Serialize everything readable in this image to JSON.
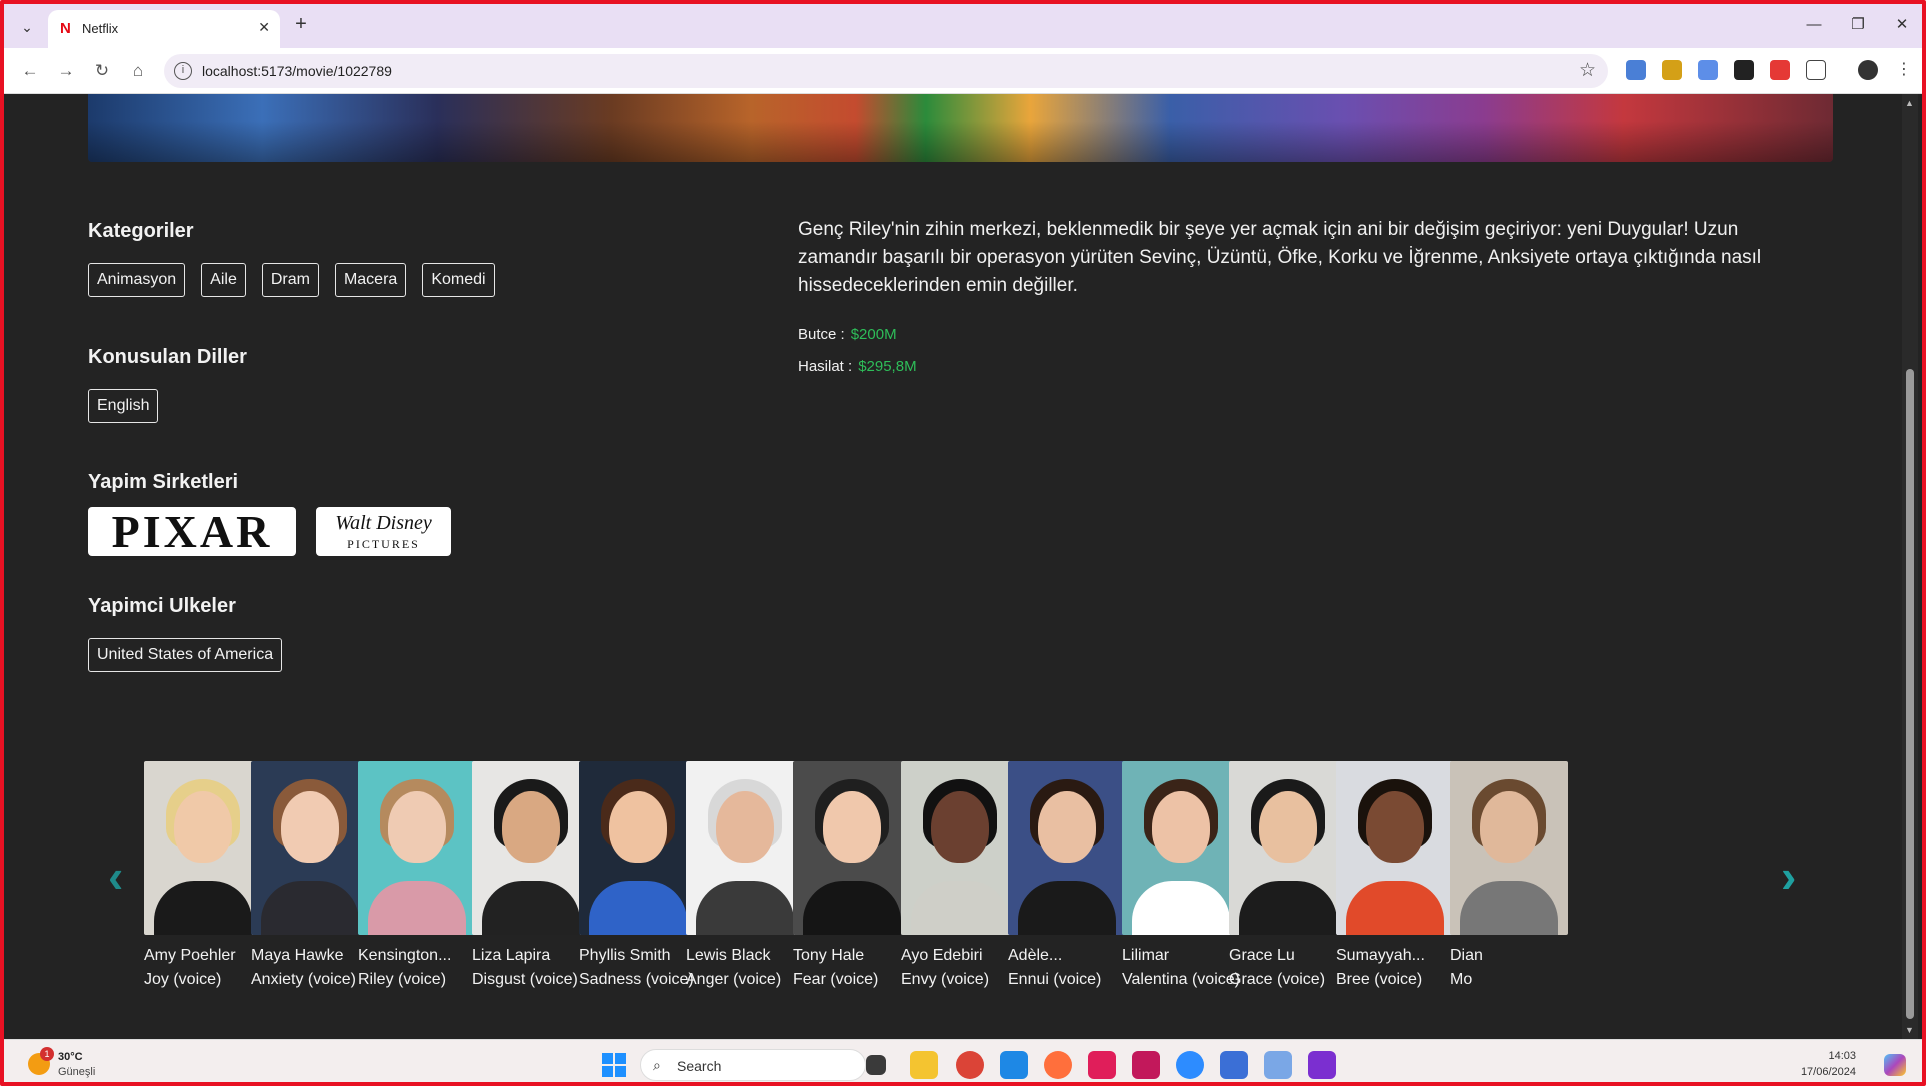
{
  "browser": {
    "tab_title": "Netflix",
    "tab_favicon": "N",
    "url": "localhost:5173/movie/1022789",
    "new_tab_symbol": "+",
    "close_symbol": "✕"
  },
  "movie": {
    "overview": "Genç Riley'nin zihin merkezi, beklenmedik bir şeye yer açmak için ani bir değişim geçiriyor: yeni Duygular! Uzun zamandır başarılı bir operasyon yürüten Sevinç, Üzüntü, Öfke, Korku ve İğrenme, Anksiyete ortaya çıktığında nasıl hissedeceklerinden emin değiller.",
    "budget_label": "Butce :",
    "budget_value": "$200M",
    "revenue_label": "Hasilat :",
    "revenue_value": "$295,8M"
  },
  "sections": {
    "categories_title": "Kategoriler",
    "categories": [
      "Animasyon",
      "Aile",
      "Dram",
      "Macera",
      "Komedi"
    ],
    "languages_title": "Konusulan Diller",
    "languages": [
      "English"
    ],
    "companies_title": "Yapim Sirketleri",
    "companies": {
      "pixar": "PIXAR",
      "disney_line1": "Walt Disney",
      "disney_line2": "PICTURES"
    },
    "countries_title": "Yapimci Ulkeler",
    "countries": [
      "United States of America"
    ]
  },
  "cast": [
    {
      "name": "Amy Poehler",
      "role": "Joy (voice)",
      "skin": "#f0c9a8",
      "hair": "#e6cf8a",
      "shirt": "#1a1a1a",
      "bg": "#d9d6cf"
    },
    {
      "name": "Maya Hawke",
      "role": "Anxiety (voice)",
      "skin": "#f1cbb2",
      "hair": "#8a5a3a",
      "shirt": "#2a2a30",
      "bg": "#2b3b55"
    },
    {
      "name": "Kensington...",
      "role": "Riley (voice)",
      "skin": "#efcbb3",
      "hair": "#b58a5e",
      "shirt": "#d99aa8",
      "bg": "#5cc3c4"
    },
    {
      "name": "Liza Lapira",
      "role": "Disgust (voice)",
      "skin": "#d9a882",
      "hair": "#1a1a1a",
      "shirt": "#222222",
      "bg": "#e7e6e4"
    },
    {
      "name": "Phyllis Smith",
      "role": "Sadness (voice)",
      "skin": "#efc2a0",
      "hair": "#4a2a1a",
      "shirt": "#2f63c8",
      "bg": "#1f2a3a"
    },
    {
      "name": "Lewis Black",
      "role": "Anger (voice)",
      "skin": "#e5b89b",
      "hair": "#d8d8d8",
      "shirt": "#3a3a3a",
      "bg": "#f1f1f1"
    },
    {
      "name": "Tony Hale",
      "role": "Fear (voice)",
      "skin": "#f0c8ac",
      "hair": "#1f1f1f",
      "shirt": "#151515",
      "bg": "#4b4b4b"
    },
    {
      "name": "Ayo Edebiri",
      "role": "Envy (voice)",
      "skin": "#6b4030",
      "hair": "#111111",
      "shirt": "#cfcfc8",
      "bg": "#cdd0c9"
    },
    {
      "name": "Adèle...",
      "role": "Ennui (voice)",
      "skin": "#e9bfa2",
      "hair": "#2a1a12",
      "shirt": "#1a1a1a",
      "bg": "#3b4f86"
    },
    {
      "name": "Lilimar",
      "role": "Valentina (voice)",
      "skin": "#edc2a6",
      "hair": "#3a2418",
      "shirt": "#ffffff",
      "bg": "#6fb3b6"
    },
    {
      "name": "Grace Lu",
      "role": "Grace (voice)",
      "skin": "#e8c09f",
      "hair": "#1a1a1a",
      "shirt": "#1c1c1c",
      "bg": "#d9d9d6"
    },
    {
      "name": "Sumayyah...",
      "role": "Bree (voice)",
      "skin": "#7a4a33",
      "hair": "#1a120c",
      "shirt": "#e14a2a",
      "bg": "#d9dbe0"
    },
    {
      "name": "Dian",
      "role": "Mo",
      "skin": "#e0b89a",
      "hair": "#6a4a30",
      "shirt": "#777777",
      "bg": "#c9c2b8"
    }
  ],
  "taskbar": {
    "weather_temp": "30°C",
    "weather_condition": "Güneşli",
    "weather_badge": "1",
    "search_placeholder": "Search",
    "time": "14:03",
    "date": "17/06/2024"
  },
  "colors": {
    "page_bg": "#232323",
    "money_green": "#2ebd59",
    "arrow_teal": "#1fa0a0",
    "frame_red": "#e81123"
  }
}
